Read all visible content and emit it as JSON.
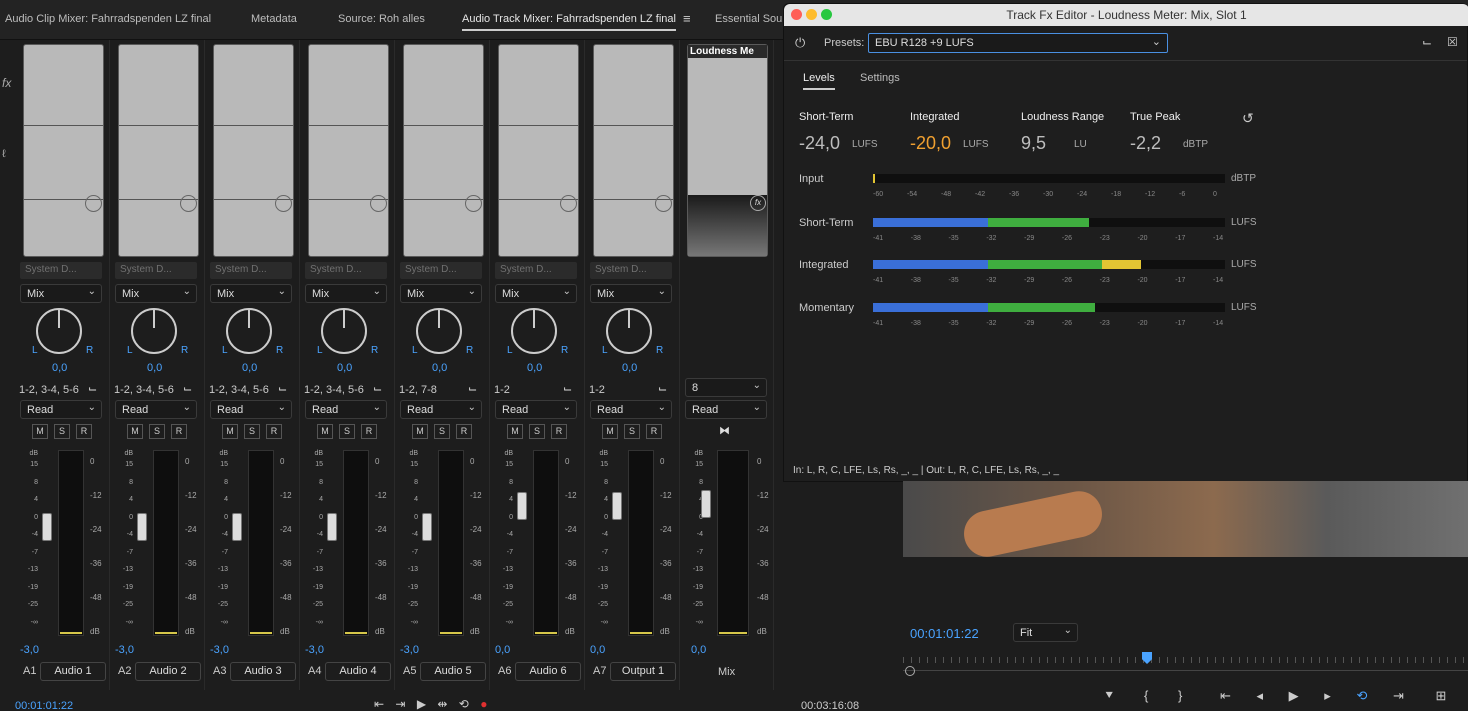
{
  "tabs": [
    {
      "label": "Audio Clip Mixer: Fahrradspenden LZ final"
    },
    {
      "label": "Metadata"
    },
    {
      "label": "Source: Roh alles"
    },
    {
      "label": "Audio Track Mixer: Fahrradspenden LZ final"
    },
    {
      "label": "Essential Sou"
    }
  ],
  "mixer": {
    "send_placeholder": "System D...",
    "mix_label": "Mix",
    "automation": "Read",
    "pan_l": "L",
    "pan_r": "R",
    "pan_value": "0,0",
    "btn_m": "M",
    "btn_s": "S",
    "btn_r": "R",
    "db_label": "dB",
    "strips": [
      {
        "id": "A1",
        "name": "Audio 1",
        "routing": "1-2, 3-4, 5-6",
        "volume": "-3,0"
      },
      {
        "id": "A2",
        "name": "Audio 2",
        "routing": "1-2, 3-4, 5-6",
        "volume": "-3,0"
      },
      {
        "id": "A3",
        "name": "Audio 3",
        "routing": "1-2, 3-4, 5-6",
        "volume": "-3,0"
      },
      {
        "id": "A4",
        "name": "Audio 4",
        "routing": "1-2, 3-4, 5-6",
        "volume": "-3,0"
      },
      {
        "id": "A5",
        "name": "Audio 5",
        "routing": "1-2, 7-8",
        "volume": "-3,0"
      },
      {
        "id": "A6",
        "name": "Audio 6",
        "routing": "1-2",
        "volume": "0,0"
      },
      {
        "id": "A7",
        "name": "Output 1",
        "routing": "1-2",
        "volume": "0,0"
      }
    ],
    "master": {
      "fx_title": "Loudness Me",
      "routing": "8",
      "automation": "Read",
      "volume": "0,0",
      "name": "Mix"
    },
    "left_scale": [
      "15",
      "8",
      "4",
      "0",
      "-4",
      "-7",
      "-13",
      "-19",
      "-25",
      "-∞"
    ],
    "right_scale": [
      "0",
      "-12",
      "-24",
      "-36",
      "-48",
      "dB"
    ]
  },
  "timecodes": {
    "left": "00:01:01:22",
    "right": "00:03:16:08",
    "preview": "00:01:01:22",
    "fit": "Fit"
  },
  "fx_editor": {
    "title": "Track Fx Editor - Loudness Meter: Mix, Slot 1",
    "presets_label": "Presets:",
    "preset_value": "EBU R128 +9 LUFS",
    "tab_levels": "Levels",
    "tab_settings": "Settings",
    "readouts": [
      {
        "label": "Short-Term",
        "value": "-24,0",
        "unit": "LUFS",
        "color": "#bdbdbd"
      },
      {
        "label": "Integrated",
        "value": "-20,0",
        "unit": "LUFS",
        "color": "#f0a030"
      },
      {
        "label": "Loudness Range",
        "value": "9,5",
        "unit": "LU",
        "color": "#bdbdbd"
      },
      {
        "label": "True Peak",
        "value": "-2,2",
        "unit": "dBTP",
        "color": "#bdbdbd"
      }
    ],
    "meters": [
      {
        "label": "Input",
        "unit": "dBTP",
        "ticks": [
          "-60",
          "-54",
          "-48",
          "-42",
          "-36",
          "-30",
          "-24",
          "-18",
          "-12",
          "-6",
          "0"
        ],
        "blue": 0,
        "green": 0,
        "yellow": 0.006
      },
      {
        "label": "Short-Term",
        "unit": "LUFS",
        "ticks": [
          "-41",
          "-38",
          "-35",
          "-32",
          "-29",
          "-26",
          "-23",
          "-20",
          "-17",
          "-14"
        ],
        "blue": 0.326,
        "green": 0.289,
        "yellow": 0
      },
      {
        "label": "Integrated",
        "unit": "LUFS",
        "ticks": [
          "-41",
          "-38",
          "-35",
          "-32",
          "-29",
          "-26",
          "-23",
          "-20",
          "-17",
          "-14"
        ],
        "blue": 0.326,
        "green": 0.324,
        "yellow": 0.11
      },
      {
        "label": "Momentary",
        "unit": "LUFS",
        "ticks": [
          "-41",
          "-38",
          "-35",
          "-32",
          "-29",
          "-26",
          "-23",
          "-20",
          "-17",
          "-14"
        ],
        "blue": 0.326,
        "green": 0.306,
        "yellow": 0
      }
    ],
    "io_text": "In: L, R, C, LFE, Ls, Rs, _, _ | Out: L, R, C, LFE, Ls, Rs, _, _"
  },
  "colors": {
    "accent": "#4aa3ff",
    "integrated": "#f0a030",
    "blue_seg": "#3a6fd8",
    "green_seg": "#3fae3f",
    "yellow_seg": "#e2c533"
  }
}
